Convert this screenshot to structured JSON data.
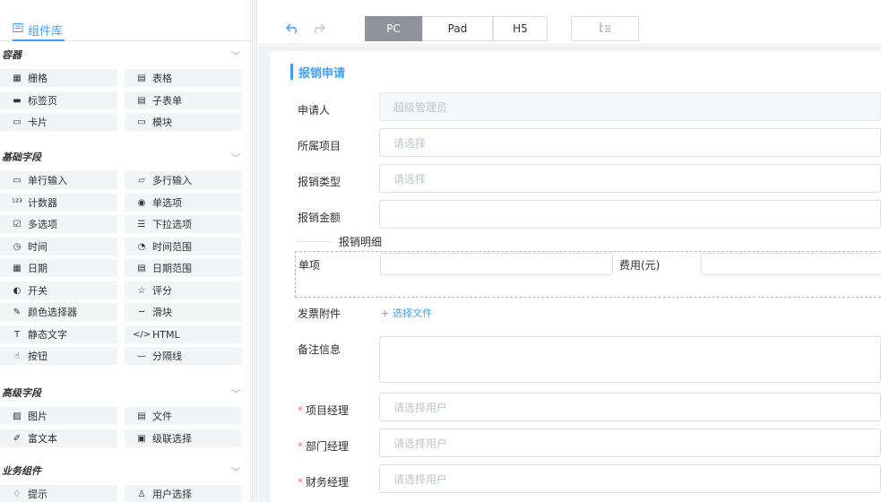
{
  "toolbar": {
    "devices": [
      "PC",
      "Pad",
      "H5"
    ],
    "active_device": "PC",
    "accent": "#409eff"
  },
  "left": {
    "tab_label": "组件库",
    "sections": [
      {
        "title": "容器",
        "items": [
          {
            "label": "栅格",
            "icon": "grid-icon"
          },
          {
            "label": "表格",
            "icon": "table-icon"
          },
          {
            "label": "标签页",
            "icon": "tabs-icon"
          },
          {
            "label": "子表单",
            "icon": "subform-icon"
          },
          {
            "label": "卡片",
            "icon": "card-icon"
          },
          {
            "label": "模块",
            "icon": "module-icon"
          }
        ]
      },
      {
        "title": "基础字段",
        "items": [
          {
            "label": "单行输入",
            "icon": "input-icon"
          },
          {
            "label": "多行输入",
            "icon": "textarea-icon"
          },
          {
            "label": "计数器",
            "icon": "counter-icon"
          },
          {
            "label": "单选项",
            "icon": "radio-icon"
          },
          {
            "label": "多选项",
            "icon": "checkbox-icon"
          },
          {
            "label": "下拉选项",
            "icon": "select-icon"
          },
          {
            "label": "时间",
            "icon": "clock-icon"
          },
          {
            "label": "时间范围",
            "icon": "time-range-icon"
          },
          {
            "label": "日期",
            "icon": "calendar-icon"
          },
          {
            "label": "日期范围",
            "icon": "date-range-icon"
          },
          {
            "label": "开关",
            "icon": "switch-icon"
          },
          {
            "label": "评分",
            "icon": "star-icon"
          },
          {
            "label": "颜色选择器",
            "icon": "color-picker-icon"
          },
          {
            "label": "滑块",
            "icon": "slider-icon"
          },
          {
            "label": "静态文字",
            "icon": "text-icon"
          },
          {
            "label": "HTML",
            "icon": "html-icon"
          },
          {
            "label": "按钮",
            "icon": "button-icon"
          },
          {
            "label": "分隔线",
            "icon": "divider-icon"
          }
        ]
      },
      {
        "title": "高级字段",
        "items": [
          {
            "label": "图片",
            "icon": "image-icon"
          },
          {
            "label": "文件",
            "icon": "file-icon"
          },
          {
            "label": "富文本",
            "icon": "rich-text-icon"
          },
          {
            "label": "级联选择",
            "icon": "cascader-icon"
          }
        ]
      },
      {
        "title": "业务组件",
        "items": [
          {
            "label": "提示",
            "icon": "hint-icon"
          },
          {
            "label": "用户选择",
            "icon": "user-icon"
          }
        ]
      }
    ]
  },
  "form": {
    "title": "报销申请",
    "fields": {
      "applicant": {
        "label": "申请人",
        "value": "超级管理员"
      },
      "project": {
        "label": "所属项目",
        "placeholder": "请选择"
      },
      "type": {
        "label": "报销类型",
        "placeholder": "请选择"
      },
      "amount": {
        "label": "报销金额",
        "value": ""
      }
    },
    "detail": {
      "title": "报销明细",
      "item_label": "单项",
      "cost_label": "费用(元)"
    },
    "attachment": {
      "label": "发票附件",
      "button": "选择文件"
    },
    "remark": {
      "label": "备注信息"
    },
    "approvers": [
      {
        "label": "项目经理",
        "placeholder": "请选择用户"
      },
      {
        "label": "部门经理",
        "placeholder": "请选择用户"
      },
      {
        "label": "财务经理",
        "placeholder": "请选择用户"
      }
    ]
  }
}
